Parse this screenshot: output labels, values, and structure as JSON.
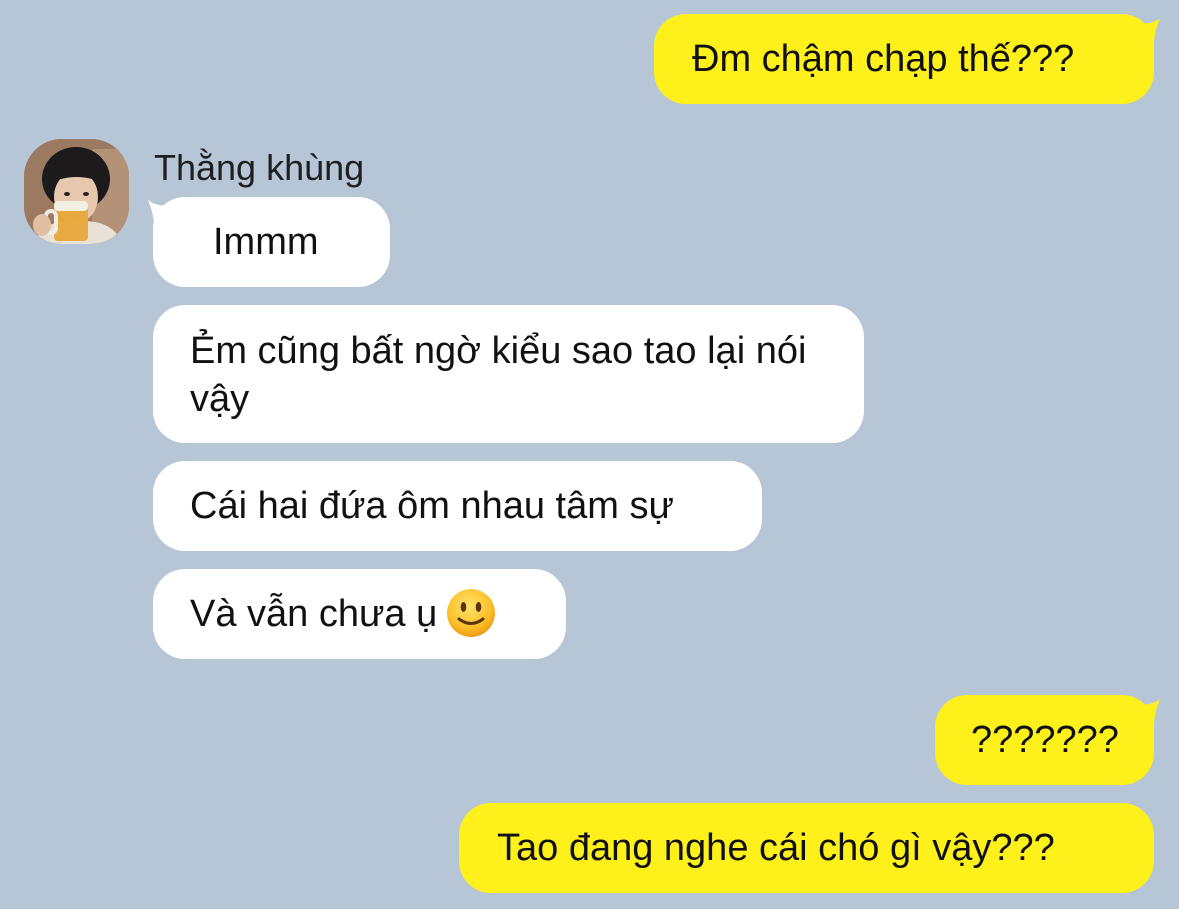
{
  "conversation": {
    "contact_name": "Thằng khùng",
    "avatar_icon": "profile-photo-person-with-beer-icon",
    "colors": {
      "background": "#b6c6d7",
      "outgoing_bubble": "#fef01b",
      "incoming_bubble": "#ffffff",
      "text": "#111111"
    },
    "messages": [
      {
        "direction": "outgoing",
        "text": "Đm chậm chạp thế???"
      },
      {
        "direction": "incoming",
        "text": "Immm"
      },
      {
        "direction": "incoming",
        "text": "Ẻm cũng bất ngờ kiểu sao tao lại nói vậy"
      },
      {
        "direction": "incoming",
        "text": "Cái hai đứa ôm nhau tâm sự"
      },
      {
        "direction": "incoming",
        "text": "Và vẫn chưa ụ",
        "emoji": "slightly-smiling-face-icon"
      },
      {
        "direction": "outgoing",
        "text": "???????"
      },
      {
        "direction": "outgoing",
        "text": "Tao đang nghe cái chó gì vậy???"
      }
    ]
  }
}
